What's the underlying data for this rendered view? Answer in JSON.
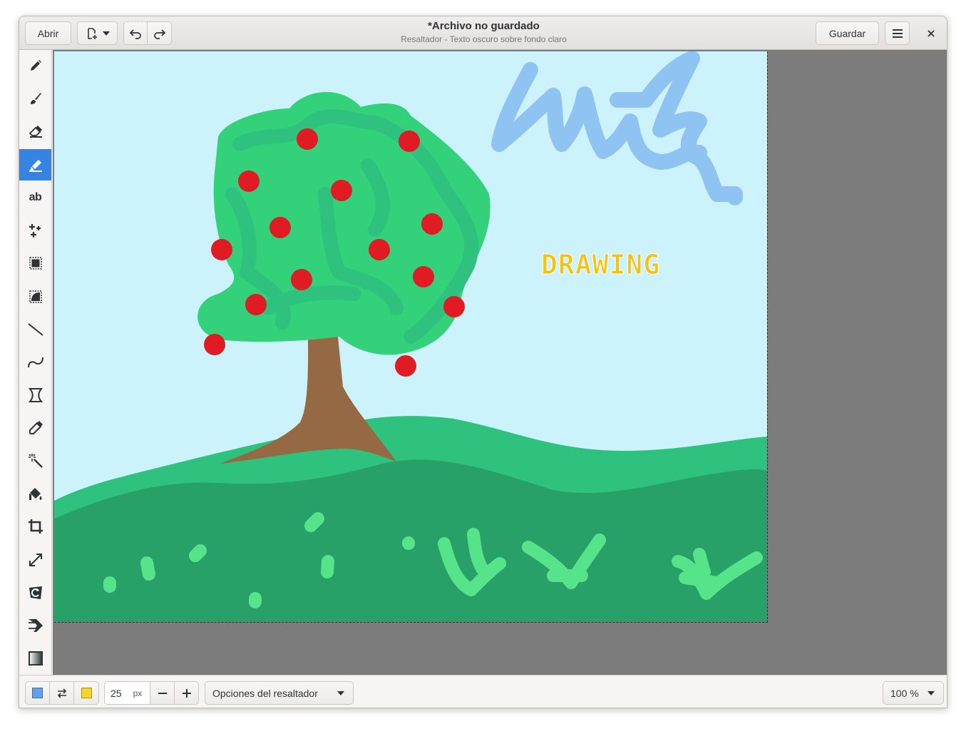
{
  "header": {
    "open_label": "Abrir",
    "save_label": "Guardar",
    "title": "*Archivo no guardado",
    "subtitle": "Resaltador - Texto oscuro sobre fondo claro"
  },
  "tools": [
    {
      "name": "pencil-icon"
    },
    {
      "name": "brush-icon"
    },
    {
      "name": "eraser-icon"
    },
    {
      "name": "highlighter-icon",
      "active": true
    },
    {
      "name": "text-icon",
      "glyph": "ab"
    },
    {
      "name": "points-icon"
    },
    {
      "name": "rectangle-selection-icon"
    },
    {
      "name": "free-selection-icon"
    },
    {
      "name": "line-icon"
    },
    {
      "name": "curve-icon"
    },
    {
      "name": "free-shape-icon"
    },
    {
      "name": "color-picker-icon"
    },
    {
      "name": "magic-wand-icon"
    },
    {
      "name": "paint-bucket-icon"
    },
    {
      "name": "crop-icon"
    },
    {
      "name": "scale-icon"
    },
    {
      "name": "rotate-icon"
    },
    {
      "name": "skew-icon"
    },
    {
      "name": "filters-icon"
    }
  ],
  "canvas": {
    "text": "DRAWING"
  },
  "bottom": {
    "main_color": "#62a0ea",
    "secondary_color": "#f6d32d",
    "size_value": "25",
    "size_unit": "px",
    "options_label": "Opciones del resaltador",
    "zoom_label": "100 %"
  },
  "colors": {
    "sky": "#ccf2fc",
    "accent": "#3584e4",
    "grass_dark": "#27a168",
    "grass_light": "#2ec27e",
    "tree": "#33d17a",
    "trunk": "#956943",
    "apple": "#e01b24",
    "cloud": "#8fc3f2",
    "text_yellow": "#f5c211"
  }
}
